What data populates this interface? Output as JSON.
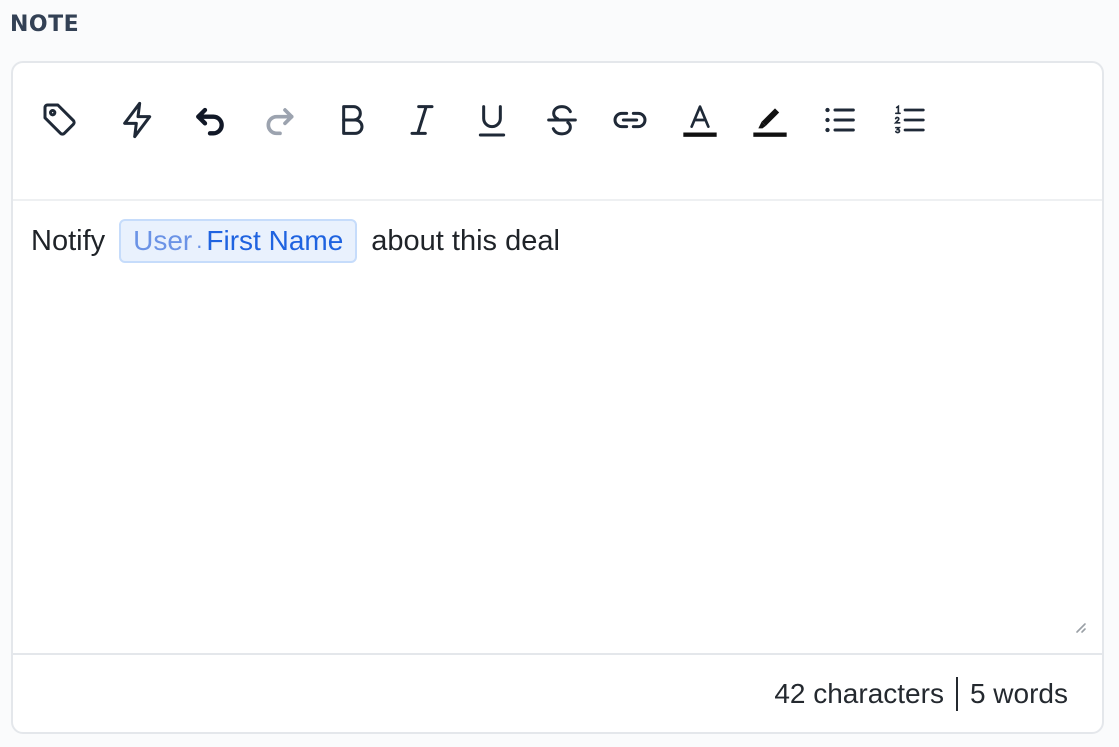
{
  "section": {
    "label": "NOTE"
  },
  "toolbar": {
    "buttons": [
      {
        "icon": "tag-icon"
      },
      {
        "icon": "lightning-icon"
      },
      {
        "icon": "undo-icon"
      },
      {
        "icon": "redo-icon"
      },
      {
        "icon": "bold-icon"
      },
      {
        "icon": "italic-icon"
      },
      {
        "icon": "underline-icon"
      },
      {
        "icon": "strikethrough-icon"
      },
      {
        "icon": "link-icon"
      },
      {
        "icon": "text-color-icon"
      },
      {
        "icon": "highlight-icon"
      },
      {
        "icon": "bulleted-list-icon"
      },
      {
        "icon": "numbered-list-icon"
      }
    ]
  },
  "content": {
    "prefix": "Notify",
    "variable": {
      "object": "User",
      "separator": ".",
      "field": "First Name"
    },
    "suffix": "about this deal"
  },
  "footer": {
    "characters": "42 characters",
    "words": "5 words"
  },
  "colors": {
    "chip_bg": "#e9f1fd",
    "chip_border": "#c6dcfb",
    "chip_field": "#1f63e0",
    "chip_object": "#6b93e6"
  }
}
